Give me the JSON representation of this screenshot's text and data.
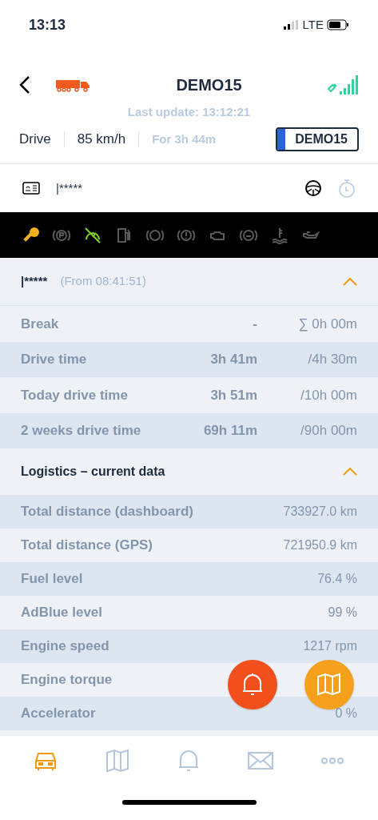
{
  "status_bar": {
    "time": "13:13",
    "network": "LTE"
  },
  "header": {
    "title": "DEMO15",
    "last_update": "Last update: 13:12:21"
  },
  "summary": {
    "state": "Drive",
    "speed": "85 km/h",
    "duration": "For 3h 44m",
    "plate": "DEMO15"
  },
  "driver": {
    "name": "|*****"
  },
  "lights": [
    {
      "kind": "key",
      "on": true,
      "color": "#f2b01e"
    },
    {
      "kind": "parking",
      "on": false
    },
    {
      "kind": "cruise",
      "on": true,
      "color": "#7ed321"
    },
    {
      "kind": "fuel",
      "on": false
    },
    {
      "kind": "brake",
      "on": false
    },
    {
      "kind": "warning",
      "on": false
    },
    {
      "kind": "engine",
      "on": false
    },
    {
      "kind": "abs",
      "on": false
    },
    {
      "kind": "coolant",
      "on": false
    },
    {
      "kind": "oil",
      "on": false
    }
  ],
  "driver_section": {
    "name": "|*****",
    "since": "(From 08:41:51)",
    "expanded": true,
    "rows": [
      {
        "label": "Break",
        "value": "-",
        "limit": "∑ 0h 00m"
      },
      {
        "label": "Drive time",
        "value": "3h 41m",
        "limit": "/4h 30m"
      },
      {
        "label": "Today drive time",
        "value": "3h 51m",
        "limit": "/10h 00m"
      },
      {
        "label": "2 weeks drive time",
        "value": "69h 11m",
        "limit": "/90h 00m"
      }
    ]
  },
  "logistics": {
    "title": "Logistics – current data",
    "expanded": true,
    "rows": [
      {
        "label": "Total distance (dashboard)",
        "value": "733927.0 km"
      },
      {
        "label": "Total distance (GPS)",
        "value": "721950.9 km"
      },
      {
        "label": "Fuel level",
        "value": "76.4 %"
      },
      {
        "label": "AdBlue level",
        "value": "99 %"
      },
      {
        "label": "Engine speed",
        "value": "1217 rpm"
      },
      {
        "label": "Engine torque"
      },
      {
        "label": "Accelerator",
        "value": "0 %"
      }
    ]
  },
  "tab_bar": [
    {
      "kind": "car",
      "selected": true
    },
    {
      "kind": "map",
      "selected": false
    },
    {
      "kind": "bell",
      "selected": false
    },
    {
      "kind": "mail",
      "selected": false
    },
    {
      "kind": "more",
      "selected": false
    }
  ]
}
